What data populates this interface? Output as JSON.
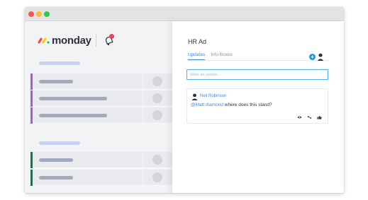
{
  "brand": {
    "name": "monday",
    "logo_colors": [
      "#ff3d57",
      "#ffcb00",
      "#00ca72"
    ]
  },
  "icons": {
    "notifications": "bell-icon",
    "add": "plus-circle-icon",
    "user": "user-icon",
    "view": "eye-icon",
    "expand": "expand-icon",
    "like": "thumbs-up-icon"
  },
  "colors": {
    "accent": "#3f8ae0",
    "input_border": "#4bb2ea",
    "group_one": "#a25ddc",
    "group_two": "#037f4c",
    "notification": "#e2445c"
  },
  "panel": {
    "title": "HR Ad",
    "tabs": [
      {
        "label": "Updates",
        "active": true
      },
      {
        "label": "Info Boxes",
        "active": false
      }
    ],
    "add_symbol": "+",
    "update_input": {
      "placeholder": "Write an update...",
      "value": ""
    },
    "update": {
      "author": "Neil Robinson",
      "mention": "@Matt diamond",
      "text": " where does this stand?"
    }
  }
}
